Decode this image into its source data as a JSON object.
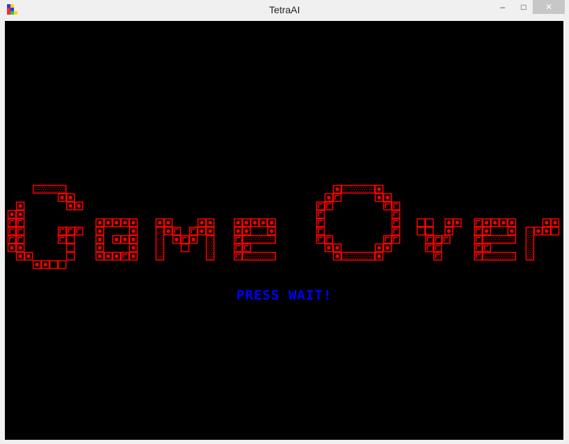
{
  "window": {
    "title": "TetraAI",
    "controls": {
      "minimize": "–",
      "maximize": "□",
      "close": "✕"
    }
  },
  "game": {
    "message": "Game Over",
    "prompt": "PRESS WAIT!",
    "colors": {
      "block": "#ff0000",
      "background": "#000000",
      "prompt": "#0000ff"
    }
  }
}
